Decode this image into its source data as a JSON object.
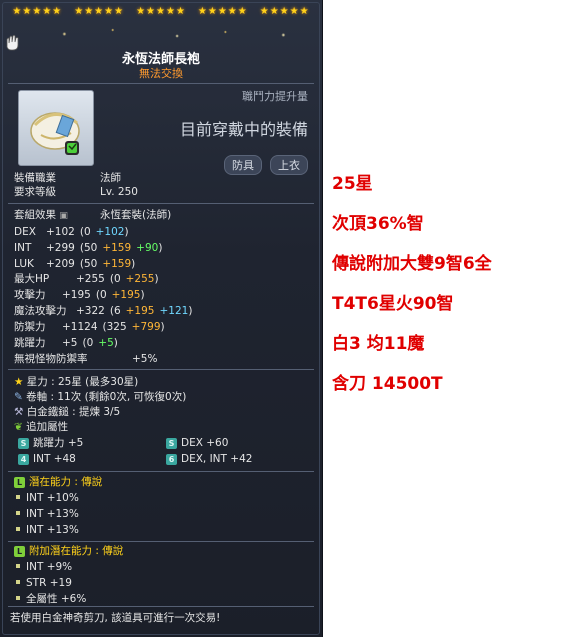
{
  "tooltip": {
    "stars_groups": [
      "★★★★★",
      "★★★★★",
      "★★★★★",
      "★★★★★",
      "★★★★★"
    ],
    "title": "永恆法師長袍",
    "trade": "無法交換",
    "power_label": "職鬥力提升量",
    "equipped": "目前穿戴中的裝備",
    "tags": [
      "防具",
      "上衣"
    ],
    "job_label": "裝備職業",
    "job_value": "法師",
    "req_level_label": "要求等級",
    "req_level_value": "Lv. 250",
    "set_label": "套組效果",
    "set_value": "永恆套裝(法師)",
    "stats": [
      {
        "label": "DEX",
        "total": "+102",
        "base": "(0",
        "a": "+102",
        "a_color": "cyan",
        "b": "",
        "close": ")"
      },
      {
        "label": "INT",
        "total": "+299",
        "base": "(50",
        "a": "+159",
        "a_color": "orange",
        "b": "+90",
        "close": ")"
      },
      {
        "label": "LUK",
        "total": "+209",
        "base": "(50",
        "a": "+159",
        "a_color": "orange",
        "b": "",
        "close": ")"
      },
      {
        "label": "最大HP",
        "total": "+255",
        "base": "(0",
        "a": "+255",
        "a_color": "orange",
        "b": "",
        "close": ")"
      },
      {
        "label": "攻擊力",
        "total": "+195",
        "base": "(0",
        "a": "+195",
        "a_color": "orange",
        "b": "",
        "close": ")"
      },
      {
        "label": "魔法攻擊力",
        "total": "+322",
        "base": "(6",
        "a": "+195",
        "a_color": "orange",
        "b": "+121",
        "close": ")"
      },
      {
        "label": "防禦力",
        "total": "+1124",
        "base": "(325",
        "a": "+799",
        "a_color": "orange",
        "b": "",
        "close": ")"
      },
      {
        "label": "跳躍力",
        "total": "+5",
        "base": "(0",
        "a": "+5",
        "a_color": "green",
        "b": "",
        "close": ")"
      }
    ],
    "ignore_def_label": "無視怪物防禦率",
    "ignore_def_value": "+5%",
    "star_force_label": "星力",
    "star_force_value": "25星 (最多30星)",
    "scroll_label": "卷軸",
    "scroll_value": "11次 (剩餘0次, 可恢復0次)",
    "hammer_label": "白金鐵鎚",
    "hammer_value": "提煉 3/5",
    "extra_label": "追加屬性",
    "extra_stats": [
      {
        "icon": "S",
        "text": "跳躍力 +5"
      },
      {
        "icon": "S",
        "text": "DEX   +60"
      },
      {
        "icon": "4",
        "text": "INT   +48"
      },
      {
        "icon": "6",
        "text": "DEX, INT   +42"
      }
    ],
    "potential_label": "潛在能力 : 傳說",
    "potential_icon": "L",
    "potential_lines": [
      "INT +10%",
      "INT +13%",
      "INT +13%"
    ],
    "bonus_potential_label": "附加潛在能力 : 傳說",
    "bonus_potential_icon": "L",
    "bonus_potential_lines": [
      "INT +9%",
      "STR +19",
      "全屬性 +6%"
    ],
    "footer": "若使用白金神奇剪刀, 該道具可進行一次交易!"
  },
  "notes": [
    "25星",
    "次頂36%智",
    "傳說附加大雙9智6全",
    "T4T6星火90智",
    "白3 均11魔",
    "含刀 14500T"
  ],
  "colors": {
    "note_red": "#e00000",
    "star_yellow": "#ffd21a",
    "trade_orange": "#ff9a2e",
    "bonus_orange": "#ffb637",
    "flame_cyan": "#70d8ff",
    "potential_green": "#7fcf3a"
  }
}
